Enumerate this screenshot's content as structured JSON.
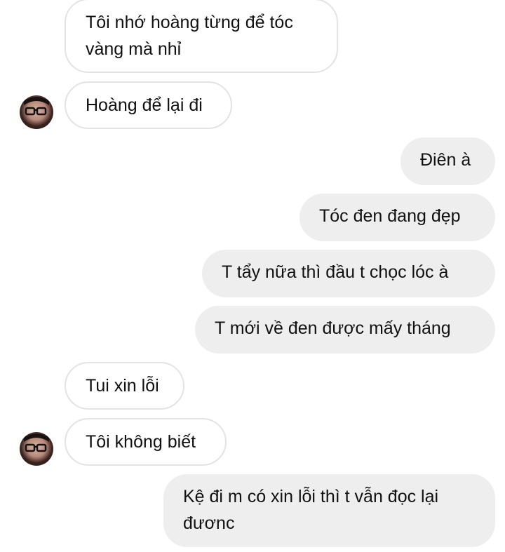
{
  "messages": [
    {
      "side": "in",
      "text": "Tôi nhớ hoàng từng để tóc\nvàng mà nhỉ"
    },
    {
      "side": "in",
      "text": "Hoàng để lại đi"
    },
    {
      "side": "out",
      "text": "Điên à"
    },
    {
      "side": "out",
      "text": "Tóc đen đang đẹp"
    },
    {
      "side": "out",
      "text": "T tẩy nữa thì đầu t chọc lóc à"
    },
    {
      "side": "out",
      "text": "T mới về đen được mấy tháng"
    },
    {
      "side": "in",
      "text": "Tui xin lỗi"
    },
    {
      "side": "in",
      "text": "Tôi không biết"
    },
    {
      "side": "out",
      "text": "Kệ đi m có xin lỗi thì t vẫn đọc lại\nđươnc"
    }
  ],
  "colors": {
    "incoming_bubble_bg": "#ffffff",
    "incoming_bubble_border": "#e3e3e3",
    "outgoing_bubble_bg": "#eeeeee",
    "text": "#111111"
  },
  "icons": {
    "avatar": "contact-avatar-photo"
  }
}
